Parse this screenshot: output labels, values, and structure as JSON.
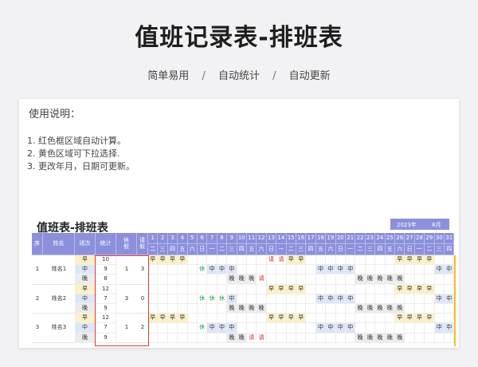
{
  "page": {
    "title": "值班记录表-排班表",
    "features": [
      "简单易用",
      "自动统计",
      "自动更新"
    ],
    "separator": "/"
  },
  "instructions": {
    "title": "使用说明：",
    "items": [
      "1. 红色框区域自动计算。",
      "2. 黄色区域可下拉选择.",
      "3. 更改年月，日期可更新。"
    ]
  },
  "sheet": {
    "title": "值班表-排班表",
    "year": "2023年",
    "month": "8月",
    "headers": {
      "seq": "序",
      "name": "姓名",
      "shift": "班次",
      "stats": "统计",
      "rest": "休\n假",
      "leave": "请\n假"
    },
    "day_numbers": [
      "1",
      "2",
      "3",
      "4",
      "5",
      "6",
      "7",
      "8",
      "9",
      "10",
      "11",
      "12",
      "13",
      "14",
      "15",
      "16",
      "17",
      "18",
      "19",
      "20",
      "21",
      "22",
      "23",
      "24",
      "25",
      "26",
      "27",
      "28",
      "29",
      "30",
      "31"
    ],
    "weekdays": [
      "二",
      "三",
      "四",
      "五",
      "六",
      "日",
      "一",
      "二",
      "三",
      "四",
      "五",
      "六",
      "日",
      "一",
      "二",
      "三",
      "四",
      "五",
      "六",
      "日",
      "一",
      "二",
      "三",
      "四",
      "五",
      "六",
      "日",
      "一",
      "二",
      "三",
      "四"
    ],
    "shift_names": [
      "早",
      "中",
      "晚"
    ],
    "colors": {
      "header": "#8c90dc",
      "early": "#fdf0c6",
      "middle": "#dce6f6",
      "night": "#ececec",
      "red_frame": "#e23c3c",
      "yellow_bar": "#f0c419",
      "rest_text": "#17a34a",
      "leave_text": "#d61f1f"
    },
    "employees": [
      {
        "seq": "1",
        "name": "姓名1",
        "rest": "1",
        "leave": "3",
        "shifts": [
          {
            "stat": "10",
            "days": [
              "早",
              "早",
              "早",
              "早",
              "",
              "",
              "",
              "",
              "",
              "",
              "",
              "",
              "请",
              "请",
              "早",
              "早",
              "",
              "",
              "",
              "",
              "",
              "",
              "",
              "",
              "",
              "早",
              "早",
              "早",
              "早",
              "",
              ""
            ]
          },
          {
            "stat": "9",
            "days": [
              "",
              "",
              "",
              "",
              "",
              "休",
              "中",
              "中",
              "中",
              "",
              "",
              "",
              "",
              "",
              "",
              "",
              "",
              "中",
              "中",
              "中",
              "中",
              "",
              "",
              "",
              "",
              "",
              "",
              "",
              "",
              "中",
              "中"
            ]
          },
          {
            "stat": "8",
            "days": [
              "",
              "",
              "",
              "",
              "",
              "",
              "",
              "",
              "晚",
              "晚",
              "晚",
              "请",
              "",
              "",
              "",
              "",
              "",
              "",
              "",
              "",
              "",
              "晚",
              "晚",
              "晚",
              "晚",
              "晚",
              "",
              "",
              "",
              "",
              ""
            ]
          }
        ]
      },
      {
        "seq": "2",
        "name": "姓名2",
        "rest": "3",
        "leave": "0",
        "shifts": [
          {
            "stat": "12",
            "days": [
              "",
              "",
              "",
              "",
              "",
              "",
              "",
              "",
              "",
              "",
              "",
              "",
              "早",
              "早",
              "早",
              "早",
              "",
              "",
              "",
              "",
              "",
              "",
              "",
              "",
              "",
              "早",
              "早",
              "早",
              "早",
              "",
              ""
            ]
          },
          {
            "stat": "7",
            "days": [
              "",
              "",
              "",
              "",
              "",
              "休",
              "休",
              "休",
              "中",
              "",
              "",
              "",
              "",
              "",
              "",
              "",
              "",
              "中",
              "中",
              "中",
              "中",
              "",
              "",
              "",
              "",
              "",
              "",
              "",
              "",
              "中",
              "中"
            ]
          },
          {
            "stat": "9",
            "days": [
              "",
              "",
              "",
              "",
              "",
              "",
              "",
              "",
              "晚",
              "晚",
              "晚",
              "晚",
              "",
              "",
              "",
              "",
              "",
              "",
              "",
              "",
              "",
              "晚",
              "晚",
              "晚",
              "晚",
              "晚",
              "",
              "",
              "",
              "",
              ""
            ]
          }
        ]
      },
      {
        "seq": "3",
        "name": "姓名3",
        "rest": "1",
        "leave": "2",
        "shifts": [
          {
            "stat": "12",
            "days": [
              "早",
              "早",
              "早",
              "早",
              "",
              "",
              "",
              "",
              "",
              "",
              "",
              "",
              "早",
              "早",
              "早",
              "早",
              "",
              "",
              "",
              "",
              "",
              "",
              "",
              "",
              "",
              "早",
              "早",
              "早",
              "早",
              "",
              ""
            ]
          },
          {
            "stat": "7",
            "days": [
              "",
              "",
              "",
              "",
              "",
              "休",
              "中",
              "中",
              "中",
              "",
              "",
              "",
              "",
              "",
              "",
              "",
              "",
              "中",
              "中",
              "中",
              "中",
              "",
              "",
              "",
              "",
              "",
              "",
              "",
              "",
              "中",
              "中"
            ]
          },
          {
            "stat": "9",
            "days": [
              "",
              "",
              "",
              "",
              "",
              "",
              "",
              "",
              "晚",
              "晚",
              "请",
              "请",
              "",
              "",
              "",
              "",
              "",
              "",
              "",
              "",
              "",
              "晚",
              "晚",
              "晚",
              "晚",
              "晚",
              "",
              "",
              "",
              "",
              ""
            ]
          }
        ]
      }
    ]
  }
}
